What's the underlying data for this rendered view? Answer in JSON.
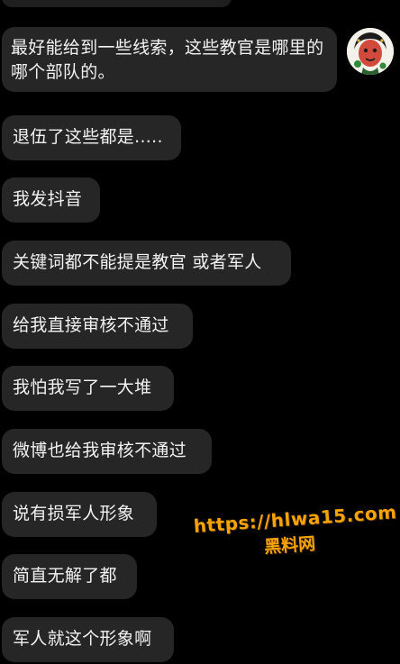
{
  "messages": [
    {
      "text": "最好能给到一些线索，这些教官是哪里的哪个部队的。"
    },
    {
      "text": "退伍了这些都是....."
    },
    {
      "text": "我发抖音"
    },
    {
      "text": "关键词都不能提是教官 或者军人"
    },
    {
      "text": "给我直接审核不通过"
    },
    {
      "text": "我怕我写了一大堆"
    },
    {
      "text": "微博也给我审核不通过"
    },
    {
      "text": "说有损军人形象"
    },
    {
      "text": "简直无解了都"
    },
    {
      "text": "军人就这个形象啊"
    }
  ],
  "watermark": {
    "url": "https://hlwa15.com",
    "brand": "黑料网"
  },
  "colors": {
    "background": "#000000",
    "bubble": "#262626",
    "text": "#f2f2f2",
    "watermark": "#f5a300"
  }
}
